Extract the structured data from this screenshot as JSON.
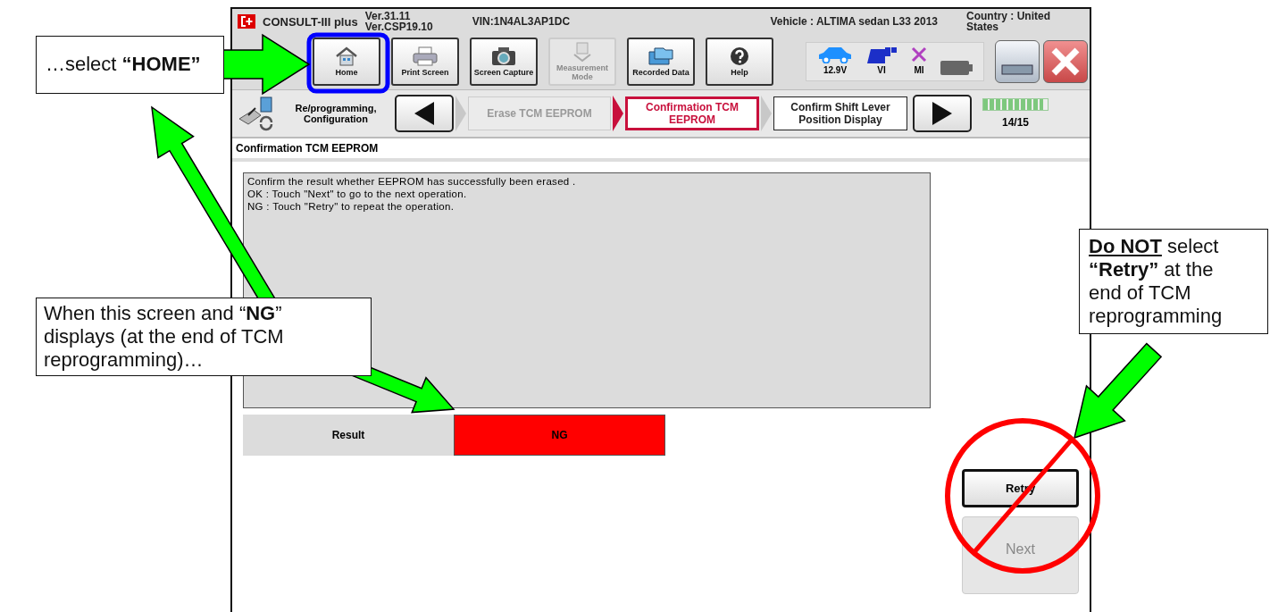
{
  "window": {
    "app_name": "CONSULT-III plus",
    "versions": [
      "Ver.31.11",
      "Ver.CSP19.10"
    ],
    "vin": "VIN:1N4AL3AP1DC",
    "vehicle": "Vehicle : ALTIMA sedan L33 2013",
    "country": "Country : United States"
  },
  "toolbar": [
    {
      "kind": "home",
      "label": "Home",
      "disabled": false
    },
    {
      "kind": "print",
      "label": "Print Screen",
      "disabled": false
    },
    {
      "kind": "camera",
      "label": "Screen Capture",
      "disabled": false
    },
    {
      "kind": "measure",
      "label": "Measurement Mode",
      "disabled": true
    },
    {
      "kind": "recorded",
      "label": "Recorded Data",
      "disabled": false
    },
    {
      "kind": "help",
      "label": "Help",
      "disabled": false
    }
  ],
  "status": [
    {
      "kind": "car",
      "label": "12.9V"
    },
    {
      "kind": "vi",
      "label": "VI"
    },
    {
      "kind": "mi",
      "label": "MI"
    },
    {
      "kind": "battery"
    }
  ],
  "breadcrumb": {
    "section": "Re/programming, Configuration",
    "steps": [
      {
        "label": "Erase TCM EEPROM",
        "selected": false,
        "disabled": true
      },
      {
        "label": "Confirmation TCM EEPROM",
        "selected": true,
        "disabled": false
      },
      {
        "label": "Confirm Shift Lever Position Display",
        "selected": false,
        "disabled": false
      }
    ],
    "progress": {
      "level": 0.93,
      "text": "14/15"
    }
  },
  "page_title": "Confirmation TCM EEPROM",
  "message": [
    "Confirm the result whether EEPROM has successfully been erased .",
    "OK : Touch \"Next\" to go to the next operation.",
    "NG : Touch \"Retry\" to repeat the operation."
  ],
  "result": {
    "label": "Result",
    "value": "NG",
    "ok": false
  },
  "buttons": [
    {
      "label": "Retry",
      "disabled": false
    },
    {
      "label": "Next",
      "disabled": true
    }
  ],
  "annotations": [
    {
      "text": "…select **“HOME”**"
    },
    {
      "text": "When this screen and “**NG**” displays (at the end of TCM reprogramming)…"
    },
    {
      "text": "**Do NOT** select **“Retry”** at the end of TCM reprogramming"
    }
  ]
}
